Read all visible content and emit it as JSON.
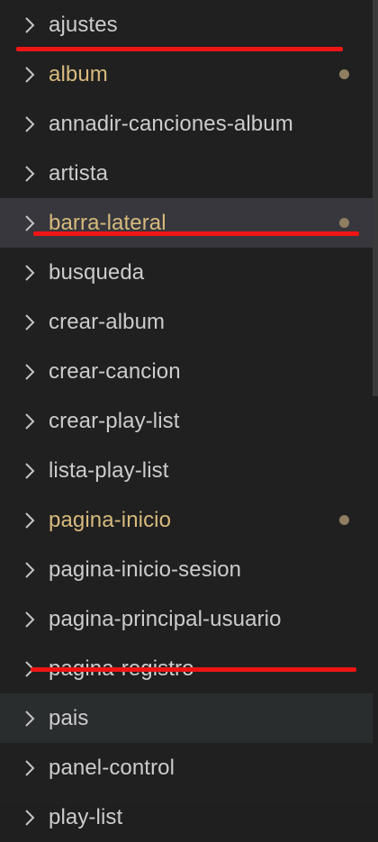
{
  "explorer": {
    "items": [
      {
        "label": "ajustes",
        "modified": false
      },
      {
        "label": "album",
        "modified": true
      },
      {
        "label": "annadir-canciones-album",
        "modified": false
      },
      {
        "label": "artista",
        "modified": false
      },
      {
        "label": "barra-lateral",
        "modified": true
      },
      {
        "label": "busqueda",
        "modified": false
      },
      {
        "label": "crear-album",
        "modified": false
      },
      {
        "label": "crear-cancion",
        "modified": false
      },
      {
        "label": "crear-play-list",
        "modified": false
      },
      {
        "label": "lista-play-list",
        "modified": false
      },
      {
        "label": "pagina-inicio",
        "modified": true
      },
      {
        "label": "pagina-inicio-sesion",
        "modified": false
      },
      {
        "label": "pagina-principal-usuario",
        "modified": false
      },
      {
        "label": "pagina-registro",
        "modified": false
      },
      {
        "label": "pais",
        "modified": false
      },
      {
        "label": "panel-control",
        "modified": false
      },
      {
        "label": "play-list",
        "modified": false
      }
    ],
    "chevron_icon": "chevron-right-icon",
    "colors": {
      "text": "#cccccc",
      "modified_text": "#d7ba7d",
      "modified_dot": "#8f7f60",
      "annotation_underline": "#ef1515",
      "background": "#202020",
      "selected_row": "#37373d",
      "hover_row": "#2a2d2e"
    }
  }
}
